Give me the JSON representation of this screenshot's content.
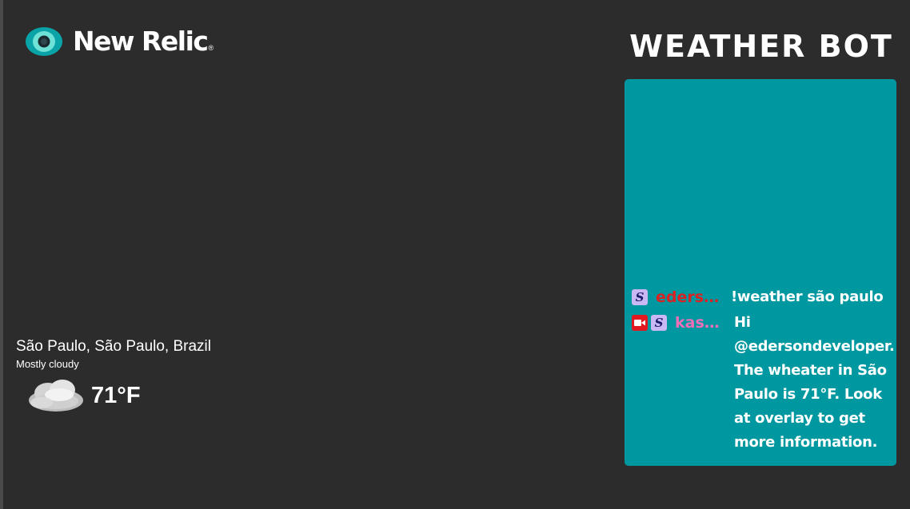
{
  "brand": {
    "name": "New Relic",
    "reg_mark": "®",
    "logo_icon": "new-relic-eye-logo",
    "accent_color": "#1ce783"
  },
  "overlay": {
    "title": "WEATHER BOT",
    "panel_color": "#0098a0"
  },
  "chat": {
    "messages": [
      {
        "badges": [
          "subscriber-badge-icon"
        ],
        "username": "edersondeveloper",
        "username_color": "#d92222",
        "text": "!weather são paulo"
      },
      {
        "badges": [
          "broadcaster-camera-icon",
          "subscriber-badge-icon"
        ],
        "username": "kastbot",
        "username_color": "#ee6fb8",
        "text": "Hi @edersondeveloper. The wheater in São Paulo is 71°F. Look at overlay to get more information."
      }
    ]
  },
  "weather": {
    "location": "São Paulo, São Paulo, Brazil",
    "condition": "Mostly cloudy",
    "icon": "cloud-icon",
    "temperature": "71°F"
  }
}
